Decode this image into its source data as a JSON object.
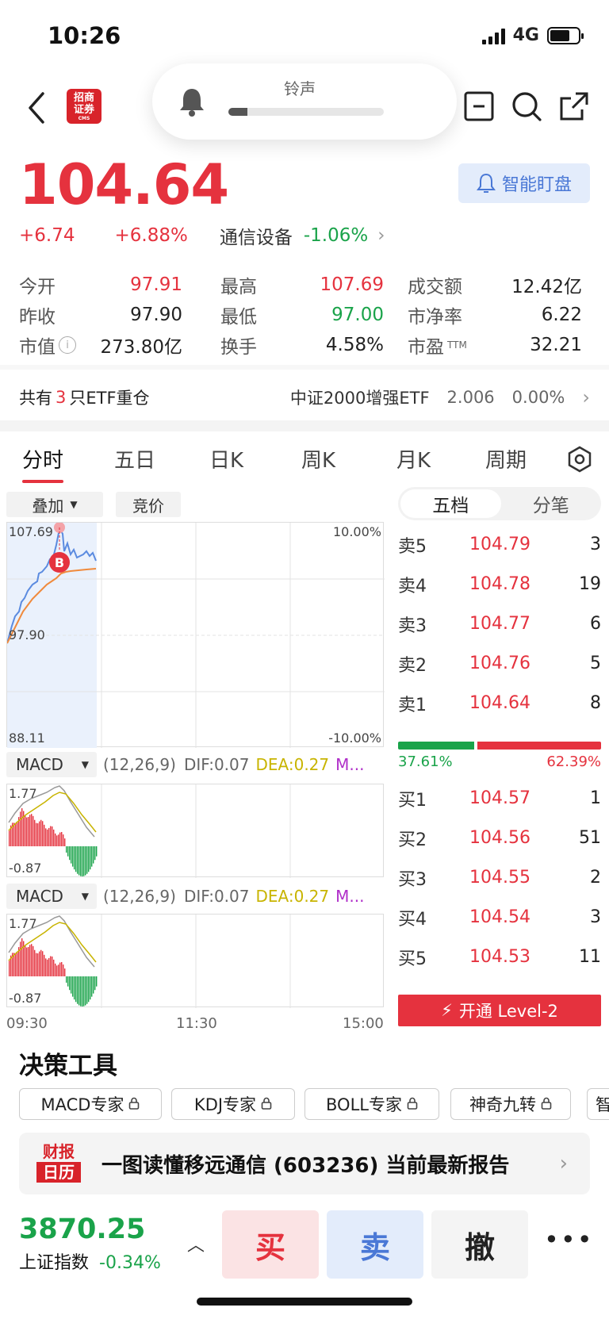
{
  "status_bar": {
    "time": "10:26",
    "network": "4G"
  },
  "header": {
    "logo_line1": "招商",
    "logo_line2": "证券",
    "logo_sub": "CMS",
    "ringer_label": "铃声",
    "ringer_level": 0.12
  },
  "quote": {
    "price": "104.64",
    "change": "+6.74",
    "change_pct": "+6.88%",
    "sector": "通信设备",
    "sector_pct": "-1.06%",
    "smart_button": "智能盯盘"
  },
  "stats": [
    [
      {
        "k": "今开",
        "v": "97.91",
        "c": "red"
      },
      {
        "k": "最高",
        "v": "107.69",
        "c": "red"
      },
      {
        "k": "成交额",
        "v": "12.42亿",
        "c": ""
      }
    ],
    [
      {
        "k": "昨收",
        "v": "97.90",
        "c": ""
      },
      {
        "k": "最低",
        "v": "97.00",
        "c": "green"
      },
      {
        "k": "市净率",
        "v": "6.22",
        "c": ""
      }
    ],
    [
      {
        "k": "市值",
        "v": "273.80亿",
        "c": ""
      },
      {
        "k": "换手",
        "v": "4.58%",
        "c": ""
      },
      {
        "k": "市盈",
        "v": "32.21",
        "c": ""
      }
    ]
  ],
  "stats_ttm": "TTM",
  "etf": {
    "prefix": "共有",
    "count": "3",
    "suffix": "只ETF重仓",
    "name": "中证2000增强ETF",
    "price": "2.006",
    "pct": "0.00%"
  },
  "tabs": [
    "分时",
    "五日",
    "日K",
    "周K",
    "月K",
    "周期"
  ],
  "chart": {
    "overlay_chip": "叠加",
    "auction_chip": "竞价",
    "y_high": "107.69",
    "y_mid": "97.90",
    "y_low": "88.11",
    "pct_high": "10.00%",
    "pct_low": "-10.00%",
    "marker": "B",
    "time_start": "09:30",
    "time_mid": "11:30",
    "time_end": "15:00"
  },
  "macd": [
    {
      "name": "MACD",
      "params": "(12,26,9)",
      "dif_label": "DIF:",
      "dif": "0.07",
      "dea_label": "DEA:",
      "dea": "0.27",
      "m": "M...",
      "max": "1.77",
      "min": "-0.87"
    },
    {
      "name": "MACD",
      "params": "(12,26,9)",
      "dif_label": "DIF:",
      "dif": "0.07",
      "dea_label": "DEA:",
      "dea": "0.27",
      "m": "M...",
      "max": "1.77",
      "min": "-0.87"
    }
  ],
  "orderbook": {
    "tab_active": "五档",
    "tab_other": "分笔",
    "asks": [
      {
        "label": "卖5",
        "price": "104.79",
        "vol": "3"
      },
      {
        "label": "卖4",
        "price": "104.78",
        "vol": "19"
      },
      {
        "label": "卖3",
        "price": "104.77",
        "vol": "6"
      },
      {
        "label": "卖2",
        "price": "104.76",
        "vol": "5"
      },
      {
        "label": "卖1",
        "price": "104.64",
        "vol": "8"
      }
    ],
    "buy_ratio": "37.61%",
    "sell_ratio": "62.39%",
    "buy_ratio_value": 0.3761,
    "bids": [
      {
        "label": "买1",
        "price": "104.57",
        "vol": "1"
      },
      {
        "label": "买2",
        "price": "104.56",
        "vol": "51"
      },
      {
        "label": "买3",
        "price": "104.55",
        "vol": "2"
      },
      {
        "label": "买4",
        "price": "104.54",
        "vol": "3"
      },
      {
        "label": "买5",
        "price": "104.53",
        "vol": "11"
      }
    ],
    "level2_button": "开通 Level-2"
  },
  "tools": {
    "title": "决策工具",
    "items": [
      "MACD专家",
      "KDJ专家",
      "BOLL专家",
      "神奇九转",
      "智"
    ]
  },
  "report": {
    "badge_line1": "财报",
    "badge_line2": "日历",
    "text": "一图读懂移远通信 (603236) 当前最新报告"
  },
  "bottom": {
    "index_value": "3870.25",
    "index_name": "上证指数",
    "index_pct": "-0.34%",
    "buy": "买",
    "sell": "卖",
    "cancel": "撤"
  },
  "colors": {
    "up": "#e5323e",
    "down": "#1aa34a",
    "price_line": "#5b8be0",
    "avg_line": "#f08a3c"
  }
}
